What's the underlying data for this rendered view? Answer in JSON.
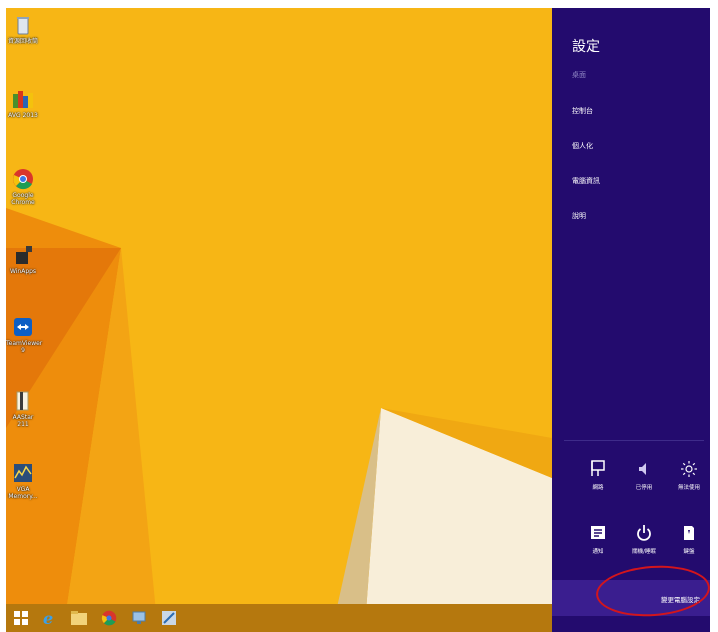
{
  "desktop": {
    "icons": [
      {
        "label": "資源回收筒",
        "icon": "recycle-bin-icon"
      },
      {
        "label": "AVG 2013",
        "icon": "avg-icon"
      },
      {
        "label": "Google Chrome",
        "icon": "chrome-icon"
      },
      {
        "label": "WinApps",
        "icon": "app-icon"
      },
      {
        "label": "TeamViewer 9",
        "icon": "teamviewer-icon"
      },
      {
        "label": "AAStar 211",
        "icon": "folder-icon"
      },
      {
        "label": "VGA Memory...",
        "icon": "vga-memory-icon"
      }
    ]
  },
  "charm": {
    "title": "設定",
    "subtitle": "桌面",
    "items": [
      "控制台",
      "個人化",
      "電腦資訊",
      "說明"
    ],
    "tiles": [
      {
        "label": "網路",
        "icon": "network-icon"
      },
      {
        "label": "已停用",
        "icon": "volume-icon"
      },
      {
        "label": "無法使用",
        "icon": "brightness-icon"
      },
      {
        "label": "通知",
        "icon": "notifications-icon"
      },
      {
        "label": "關機/睡眠",
        "icon": "power-icon"
      },
      {
        "label": "鍵盤",
        "icon": "keyboard-icon"
      }
    ],
    "change_settings": "變更電腦設定"
  },
  "taskbar": {
    "items": [
      "windows-start-icon",
      "internet-explorer-icon",
      "file-explorer-icon",
      "chrome-icon",
      "network-app-icon",
      "paint-icon"
    ]
  },
  "colors": {
    "charm_bg": "#230b6e",
    "wallpaper": "#f7b615",
    "highlight_ellipse": "#d3151c"
  }
}
